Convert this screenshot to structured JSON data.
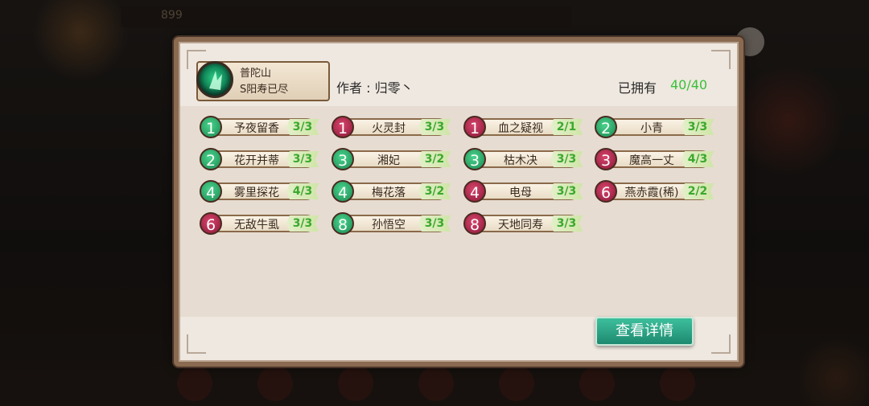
{
  "background": {
    "top_counter": "899"
  },
  "panel": {
    "school": {
      "name": "普陀山",
      "subtitle": "S阳寿已尽",
      "icon": "school-emblem-icon"
    },
    "author_text": "作者 : 归零丶",
    "owned_label": "已拥有",
    "owned_value": "40/40",
    "detail_button": "查看详情",
    "close_icon": "close-x-icon",
    "colors": {
      "green_level": "#1f9a5c",
      "red_level": "#a11f45",
      "count_text": "#3aa82e",
      "button": "#2aa585"
    },
    "cards": [
      {
        "level": "1",
        "name": "予夜留香",
        "count": "3/3",
        "color": "green"
      },
      {
        "level": "1",
        "name": "火灵封",
        "count": "3/3",
        "color": "red"
      },
      {
        "level": "1",
        "name": "血之疑视",
        "count": "2/1",
        "color": "red"
      },
      {
        "level": "2",
        "name": "小青",
        "count": "3/3",
        "color": "green"
      },
      {
        "level": "2",
        "name": "花开并蒂",
        "count": "3/3",
        "color": "green"
      },
      {
        "level": "3",
        "name": "湘妃",
        "count": "3/2",
        "color": "green"
      },
      {
        "level": "3",
        "name": "枯木决",
        "count": "3/3",
        "color": "green"
      },
      {
        "level": "3",
        "name": "魔高一丈",
        "count": "4/3",
        "color": "red"
      },
      {
        "level": "4",
        "name": "雾里探花",
        "count": "4/3",
        "color": "green"
      },
      {
        "level": "4",
        "name": "梅花落",
        "count": "3/2",
        "color": "green"
      },
      {
        "level": "4",
        "name": "电母",
        "count": "3/3",
        "color": "red"
      },
      {
        "level": "6",
        "name": "燕赤霞(稀)",
        "count": "2/2",
        "color": "red"
      },
      {
        "level": "6",
        "name": "无敌牛虱",
        "count": "3/3",
        "color": "red"
      },
      {
        "level": "8",
        "name": "孙悟空",
        "count": "3/3",
        "color": "green"
      },
      {
        "level": "8",
        "name": "天地同寿",
        "count": "3/3",
        "color": "red"
      }
    ]
  }
}
